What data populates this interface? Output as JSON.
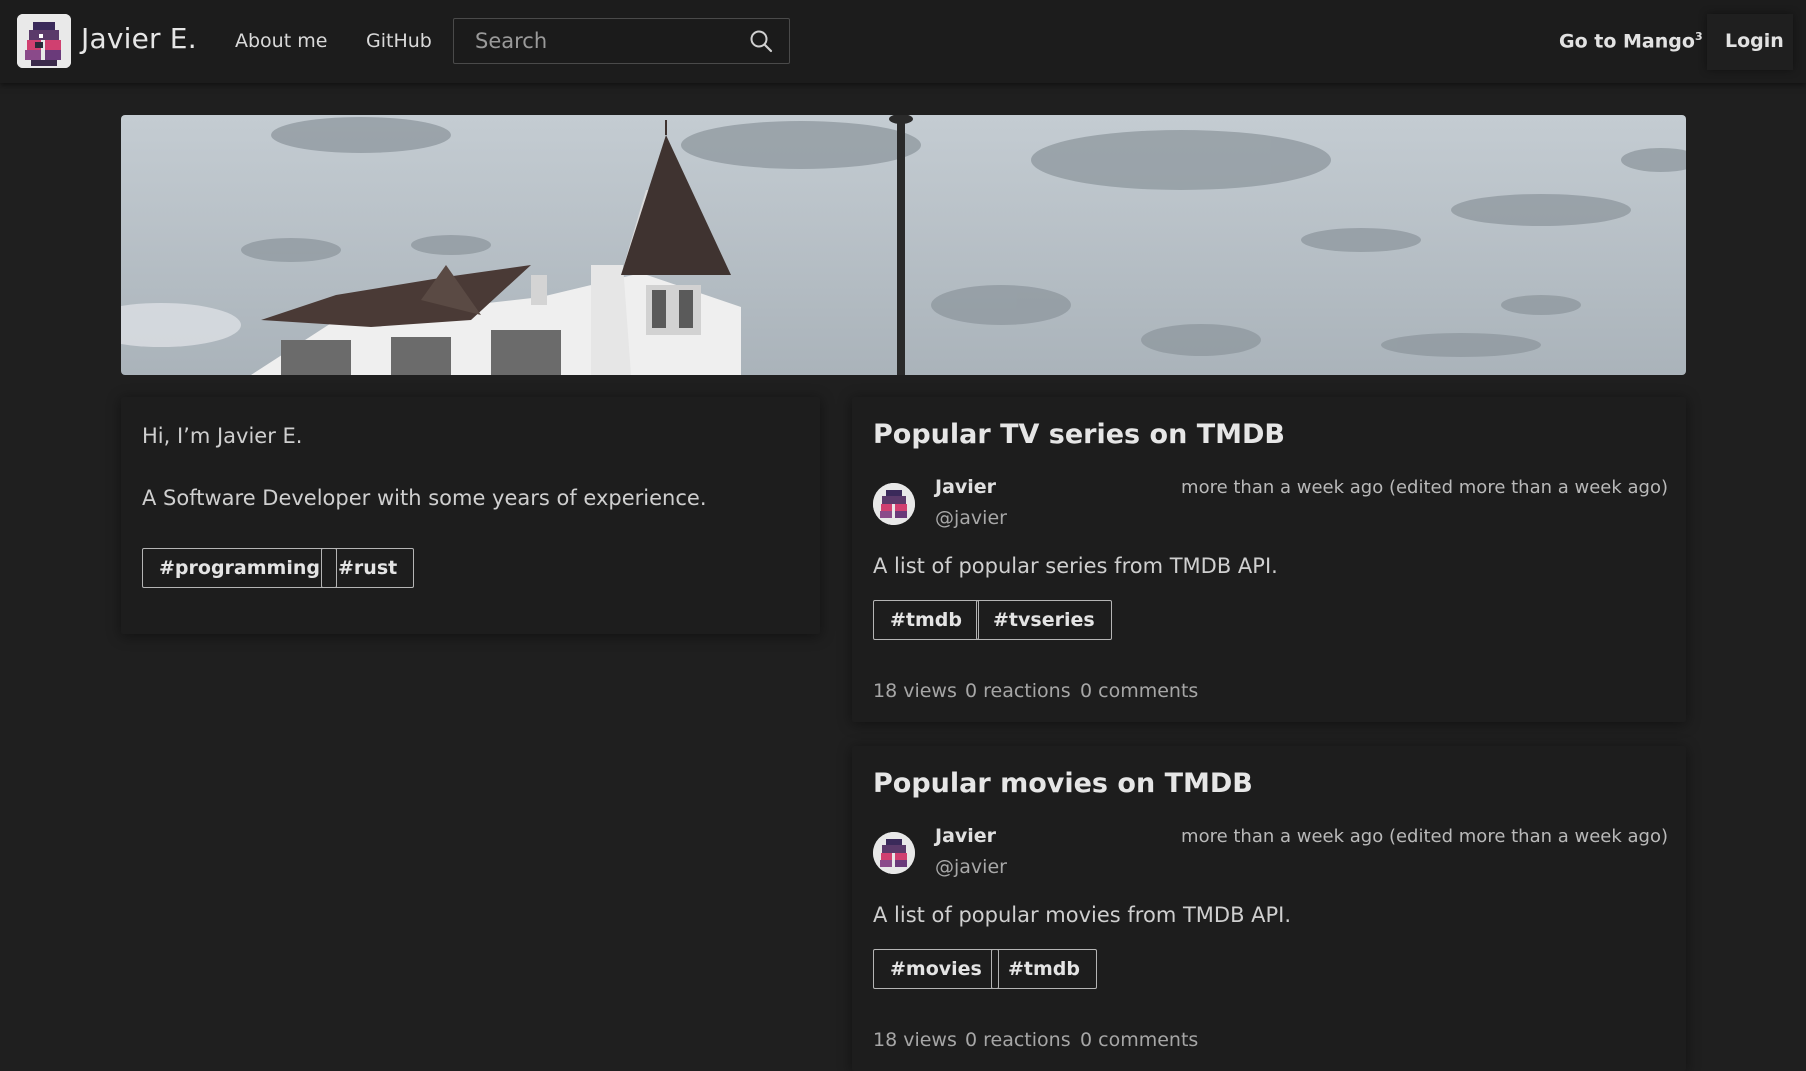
{
  "header": {
    "brand_name": "Javier E.",
    "nav": [
      "About me",
      "GitHub"
    ],
    "search_placeholder": "Search",
    "go_to_label": "Go to Mango",
    "go_to_sup": "3",
    "login_label": "Login"
  },
  "intro": {
    "greeting": "Hi, I’m Javier E.",
    "bio": "A Software Developer with some years of experience.",
    "tags": [
      "#programming",
      "#rust"
    ]
  },
  "posts": [
    {
      "title": "Popular TV series on TMDB",
      "author": "Javier",
      "handle": "@javier",
      "date": "more than a week ago (edited more than a week ago)",
      "description": "A list of popular series from TMDB API.",
      "tags": [
        "#tmdb",
        "#tvseries"
      ],
      "views": "18 views",
      "reactions": "0 reactions",
      "comments": "0 comments"
    },
    {
      "title": "Popular movies on TMDB",
      "author": "Javier",
      "handle": "@javier",
      "date": "more than a week ago (edited more than a week ago)",
      "description": "A list of popular movies from TMDB API.",
      "tags": [
        "#movies",
        "#tmdb"
      ],
      "views": "18 views",
      "reactions": "0 reactions",
      "comments": "0 comments"
    }
  ]
}
